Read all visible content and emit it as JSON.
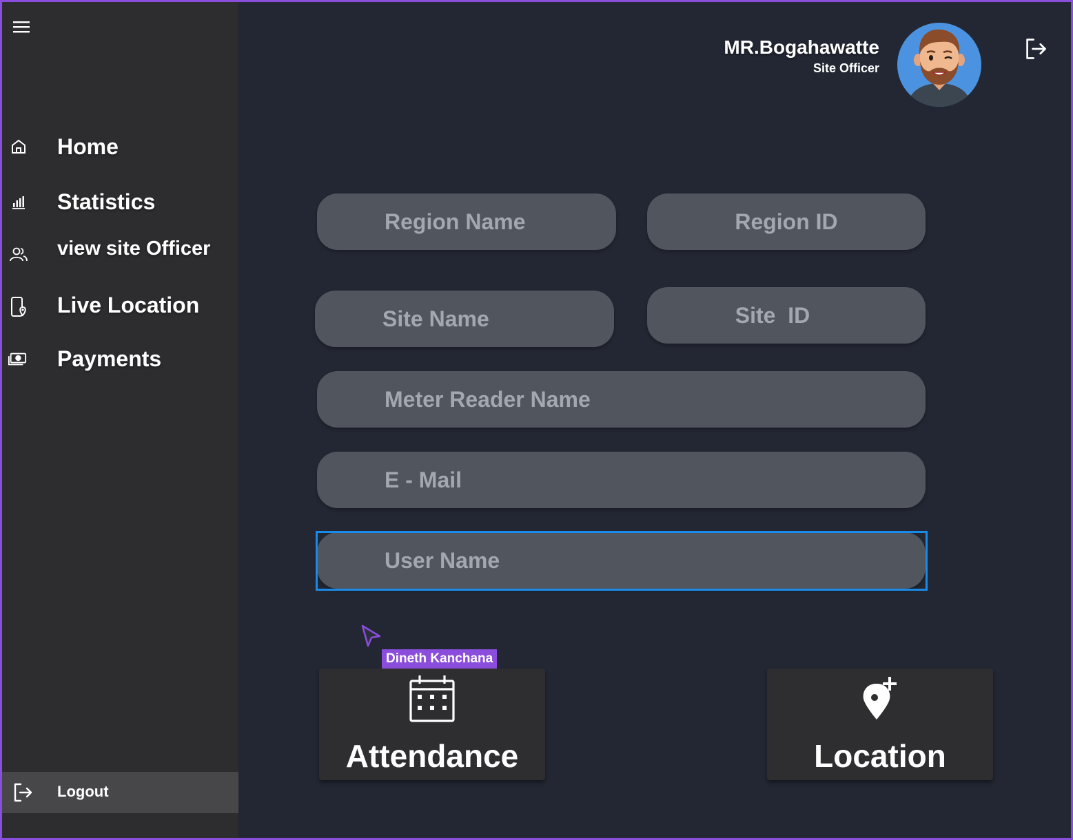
{
  "colors": {
    "frame_border": "#8b4ddb",
    "sidebar_bg": "#2d2d2f",
    "main_bg": "#232733",
    "field_bg": "#51555e",
    "field_text": "#a3a7af",
    "selection": "#1a8ae8",
    "cursor_tag": "#8b4ddb",
    "avatar_bg": "#4b93e0"
  },
  "sidebar": {
    "menu_icon": "hamburger-icon",
    "items": [
      {
        "label": "Home",
        "icon": "home-icon"
      },
      {
        "label": "Statistics",
        "icon": "bar-chart-icon"
      },
      {
        "label": "view site Officer",
        "icon": "users-icon"
      },
      {
        "label": "Live Location",
        "icon": "phone-location-icon"
      },
      {
        "label": "Payments",
        "icon": "cash-icon"
      }
    ],
    "logout": {
      "label": "Logout",
      "icon": "logout-icon"
    }
  },
  "header": {
    "user_name": "MR.Bogahawatte",
    "user_role": "Site Officer",
    "avatar_icon": "avatar-icon",
    "logout_icon": "logout-icon"
  },
  "form": {
    "region_name": {
      "placeholder": "Region Name",
      "value": ""
    },
    "region_id": {
      "placeholder": "Region ID",
      "value": ""
    },
    "site_name": {
      "placeholder": "Site Name",
      "value": ""
    },
    "site_id": {
      "placeholder": "Site  ID",
      "value": ""
    },
    "meter_reader_name": {
      "placeholder": "Meter Reader Name",
      "value": ""
    },
    "email": {
      "placeholder": "E - Mail",
      "value": ""
    },
    "user_name": {
      "placeholder": "User Name",
      "value": ""
    }
  },
  "collab_cursor": {
    "name": "Dineth Kanchana",
    "icon": "pointer-cursor-icon"
  },
  "actions": {
    "attendance": {
      "label": "Attendance",
      "icon": "calendar-icon"
    },
    "location": {
      "label": "Location",
      "icon": "add-location-icon"
    }
  }
}
